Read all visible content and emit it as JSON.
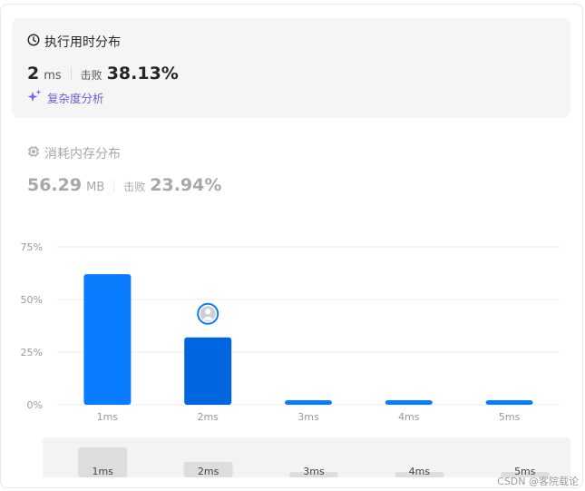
{
  "runtime": {
    "title": "执行用时分布",
    "value": "2",
    "unit": "ms",
    "beat_label": "击败",
    "beat_percent": "38.13%",
    "complexity_link": "复杂度分析"
  },
  "memory": {
    "title": "消耗内存分布",
    "value": "56.29",
    "unit": "MB",
    "beat_label": "击败",
    "beat_percent": "23.94%"
  },
  "colors": {
    "bar": "#0a7cfe",
    "bar_selected": "#0066e0",
    "muted_text": "#a8a8a8",
    "link": "#6e5cd7"
  },
  "icons": [
    "clock-icon",
    "sparkle-icon",
    "cpu-chip-icon",
    "avatar"
  ],
  "chart_data": {
    "type": "bar",
    "categories": [
      "1ms",
      "2ms",
      "3ms",
      "4ms",
      "5ms"
    ],
    "values": [
      62,
      32,
      1.5,
      1.5,
      1.5
    ],
    "y_ticks": [
      "0%",
      "25%",
      "50%",
      "75%"
    ],
    "ylim": [
      0,
      75
    ],
    "selected_category": "2ms",
    "grid": true
  },
  "overview": {
    "labels": [
      "1ms",
      "2ms",
      "3ms",
      "4ms",
      "5ms"
    ],
    "values": [
      62,
      32,
      1.5,
      1.5,
      1.5
    ]
  },
  "watermark": "CSDN @客院载论"
}
